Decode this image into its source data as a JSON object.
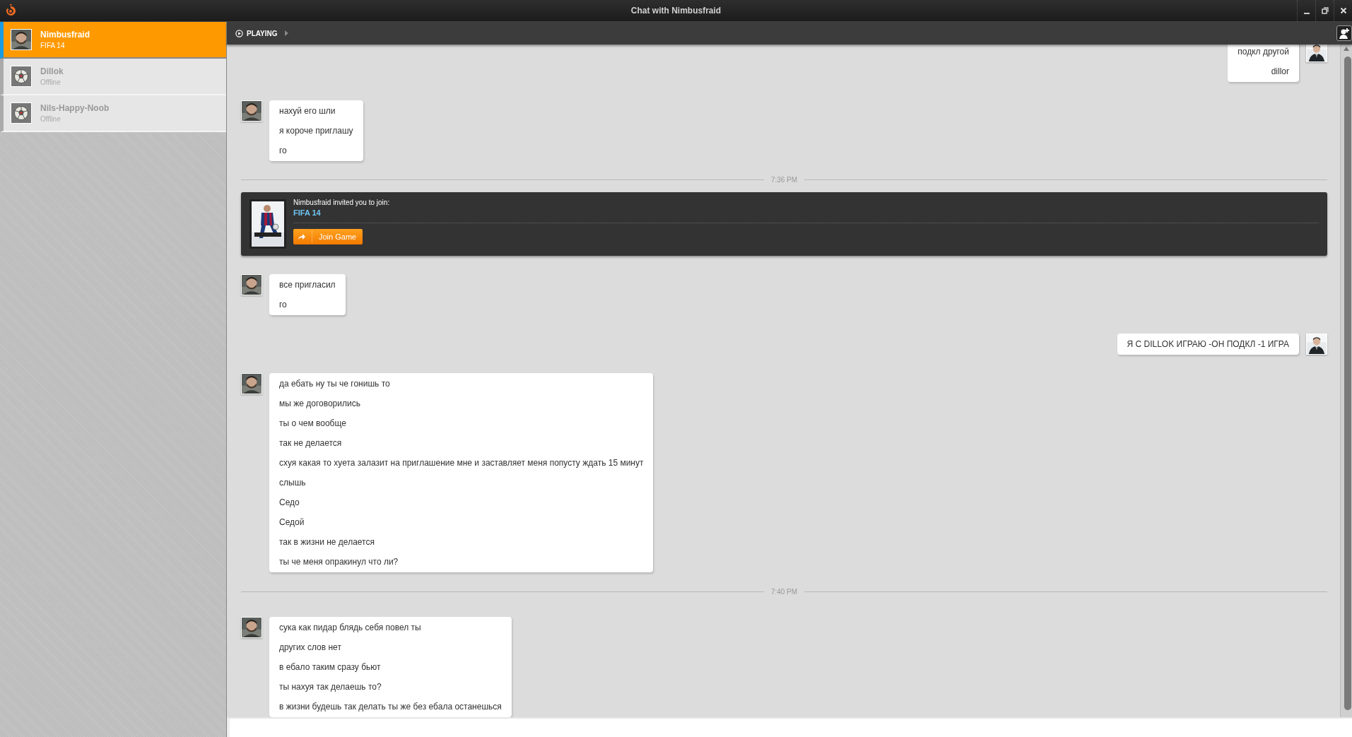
{
  "window": {
    "title": "Chat with Nimbusfraid"
  },
  "contacts": [
    {
      "name": "Nimbusfraid",
      "status": "FIFA 14",
      "selected": true
    },
    {
      "name": "Dillok",
      "status": "Offline",
      "selected": false,
      "kind": "default"
    },
    {
      "name": "Nils-Happy-Noob",
      "status": "Offline",
      "selected": false,
      "kind": "default"
    }
  ],
  "toolbar": {
    "label": "PLAYING"
  },
  "messages": [
    {
      "kind": "message",
      "outgoing": true,
      "lines": [
        "подкл другой",
        "dillor"
      ]
    },
    {
      "kind": "message",
      "outgoing": false,
      "lines": [
        "нахуй его шли",
        "я короче приглашу",
        "го"
      ]
    },
    {
      "kind": "time",
      "text": "7:36 PM"
    },
    {
      "kind": "invite",
      "text": "Nimbusfraid invited you to join:",
      "game": "FIFA 14",
      "button": "Join Game"
    },
    {
      "kind": "message",
      "outgoing": false,
      "lines": [
        "все пригласил",
        "го"
      ]
    },
    {
      "kind": "message",
      "outgoing": true,
      "lines": [
        "Я С DILLOK ИГРАЮ -ОН ПОДКЛ -1 ИГРА"
      ]
    },
    {
      "kind": "message",
      "outgoing": false,
      "lines": [
        "да ебать ну ты че гонишь то",
        "мы же договорились",
        "ты о чем вообще",
        "так не делается",
        "схуя какая то хуета залазит на приглашение мне и заставляет меня попусту ждать 15 минут",
        "слышь",
        "Седо",
        "Седой",
        "так в жизни не делается",
        "ты че меня опракинул что ли?"
      ]
    },
    {
      "kind": "time",
      "text": "7:40 PM"
    },
    {
      "kind": "message",
      "outgoing": false,
      "lines": [
        "сука как пидар блядь себя повел ты",
        "других слов нет",
        "в ебало таким сразу бьют",
        "ты нахуя так делаешь то?",
        "в жизни будешь так делать ты же без ебала останешься"
      ]
    }
  ]
}
